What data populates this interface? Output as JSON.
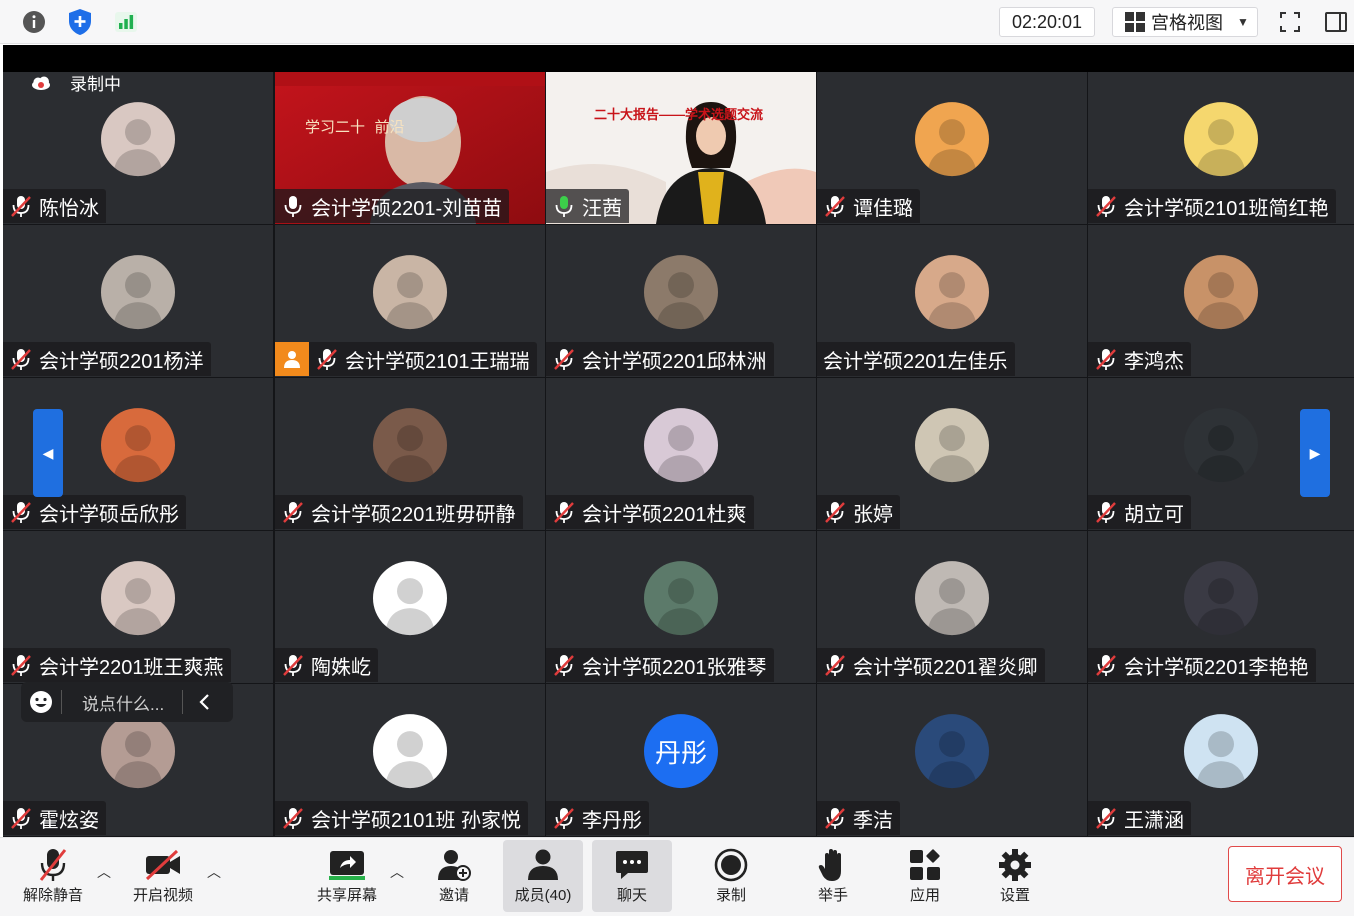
{
  "topbar": {
    "timer": "02:20:01",
    "view_label": "宫格视图"
  },
  "recording_label": "录制中",
  "tiles": [
    {
      "name": "陈怡冰",
      "mic": "muted",
      "avatar_color": "#d9c8c2"
    },
    {
      "name": "会计学硕2201-刘苗苗",
      "mic": "on",
      "video": true
    },
    {
      "name": "汪茜",
      "mic": "speaking",
      "video": true,
      "active": true
    },
    {
      "name": "谭佳璐",
      "mic": "muted",
      "avatar_color": "#f0a550"
    },
    {
      "name": "会计学硕2101班简红艳",
      "mic": "muted",
      "avatar_color": "#f5d76e"
    },
    {
      "name": "会计学硕2201杨洋",
      "mic": "muted",
      "avatar_color": "#b9b0a8"
    },
    {
      "name": "会计学硕2101王瑞瑞",
      "mic": "muted",
      "avatar_color": "#c9b5a5",
      "host_badge": true
    },
    {
      "name": "会计学硕2201邱林洲",
      "mic": "muted",
      "avatar_color": "#8c7a6a"
    },
    {
      "name": "会计学硕2201左佳乐",
      "mic": "none",
      "avatar_color": "#d7a98a"
    },
    {
      "name": "李鸿杰",
      "mic": "muted",
      "avatar_color": "#c89268"
    },
    {
      "name": "会计学硕岳欣彤",
      "mic": "muted",
      "avatar_color": "#d86a3c"
    },
    {
      "name": "会计学硕2201班毋研静",
      "mic": "muted",
      "avatar_color": "#7a5a4a"
    },
    {
      "name": "会计学硕2201杜爽",
      "mic": "muted",
      "avatar_color": "#d8c9d6"
    },
    {
      "name": "张婷",
      "mic": "muted",
      "avatar_color": "#cfc6b4"
    },
    {
      "name": "胡立可",
      "mic": "muted",
      "avatar_color": "#2e3236"
    },
    {
      "name": "会计学2201班王爽燕",
      "mic": "muted",
      "avatar_color": "#d9c8c2"
    },
    {
      "name": "陶姝屹",
      "mic": "muted",
      "avatar_color": "#ffffff"
    },
    {
      "name": "会计学硕2201张雅琴",
      "mic": "muted",
      "avatar_color": "#5c7a6a"
    },
    {
      "name": "会计学硕2201翟炎卿",
      "mic": "muted",
      "avatar_color": "#bfb9b4"
    },
    {
      "name": "会计学硕2201李艳艳",
      "mic": "muted",
      "avatar_color": "#3a3a44"
    },
    {
      "name": "霍炫姿",
      "mic": "muted",
      "avatar_color": "#b49c94"
    },
    {
      "name": "会计学硕2101班 孙家悦",
      "mic": "muted",
      "avatar_color": "#ffffff"
    },
    {
      "name": "李丹彤",
      "mic": "muted",
      "avatar_color": "#1c6ef2",
      "avatar_text": "丹彤"
    },
    {
      "name": "季洁",
      "mic": "muted",
      "avatar_color": "#2a4a7a"
    },
    {
      "name": "王潇涵",
      "mic": "muted",
      "avatar_color": "#cfe3f2"
    }
  ],
  "video_text": {
    "tile2_banner": "二十大报告——学术选题交流",
    "tile1_banner": "学习二十  前沿"
  },
  "chat": {
    "placeholder": "说点什么..."
  },
  "toolbar": {
    "unmute": "解除静音",
    "video": "开启视频",
    "share": "共享屏幕",
    "invite": "邀请",
    "members": "成员(40)",
    "chat": "聊天",
    "record": "录制",
    "raise_hand": "举手",
    "apps": "应用",
    "settings": "设置",
    "leave": "离开会议"
  }
}
